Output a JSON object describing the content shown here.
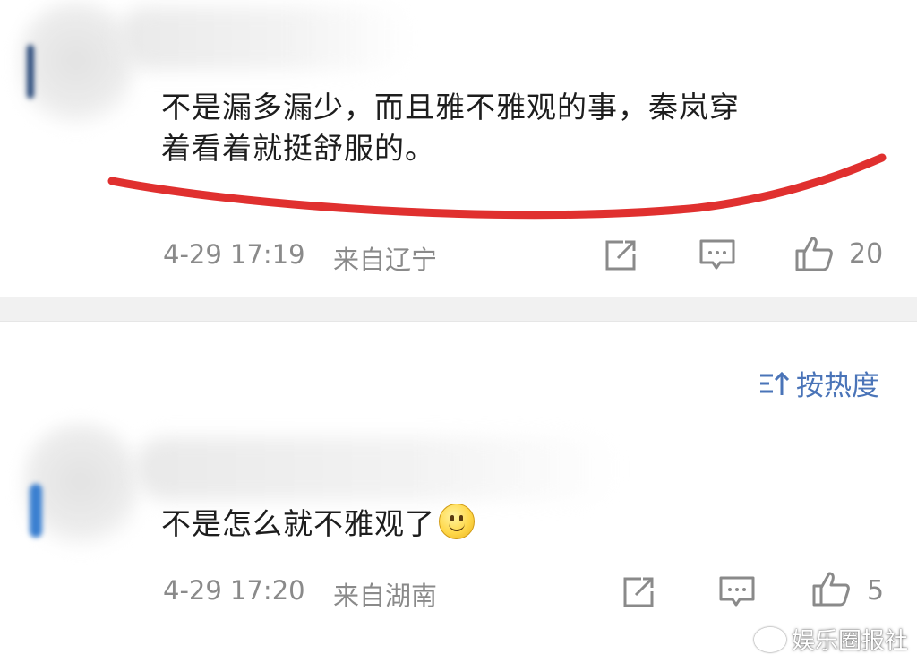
{
  "comments": [
    {
      "text_line1": "不是漏多漏少，而且雅不雅观的事，秦岚穿",
      "text_line2": "着看着就挺舒服的。",
      "timestamp": "4-29 17:19",
      "location": "来自辽宁",
      "likes": "20"
    },
    {
      "text": "不是怎么就不雅观了",
      "emoji": "smile-emoji",
      "timestamp": "4-29 17:20",
      "location": "来自湖南",
      "likes": "5"
    }
  ],
  "sort_label": "按热度",
  "watermark": "娱乐圈报社",
  "colors": {
    "highlight_underline": "#e0302f",
    "meta_text": "#8a8a8a",
    "sort_link": "#4a74b8",
    "separator": "#f1f1f1"
  },
  "icons": {
    "share": "share-icon",
    "reply": "comment-icon",
    "like": "thumbs-up-icon",
    "sort": "sort-icon"
  }
}
